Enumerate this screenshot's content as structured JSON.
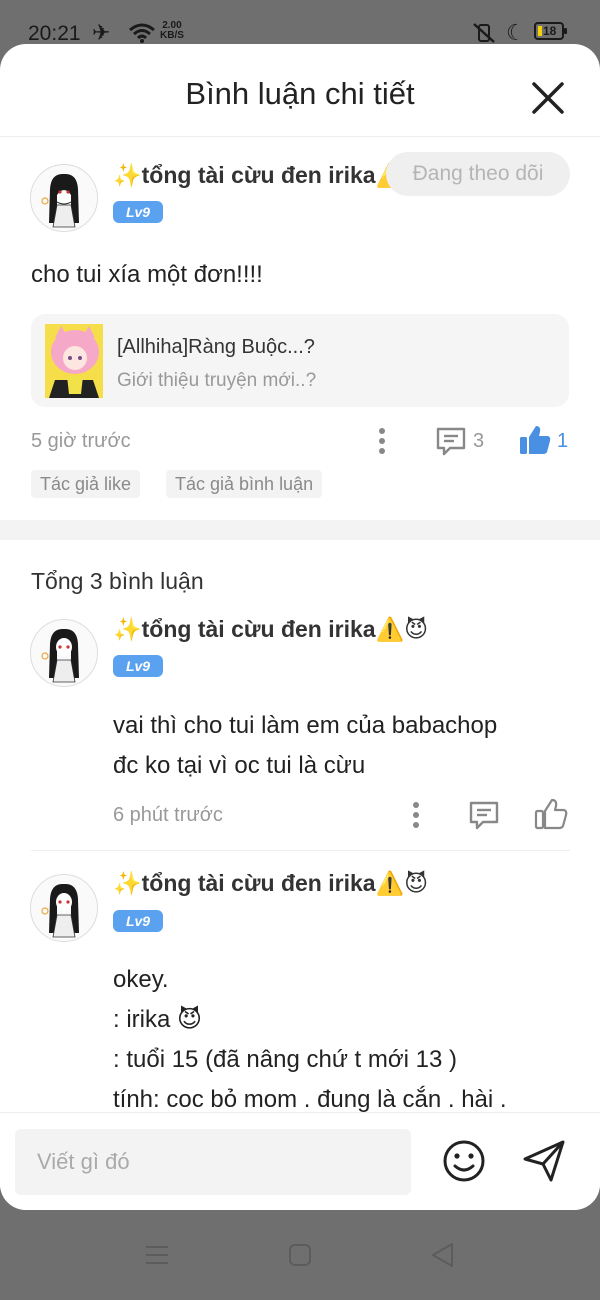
{
  "status": {
    "time": "20:21",
    "speed_top": "2.00",
    "speed_bottom": "KB/S",
    "battery": "18"
  },
  "header": {
    "title": "Bình luận chi tiết"
  },
  "post": {
    "username": "✨tổng tài cừu đen irika⚠️😈",
    "level": "Lv9",
    "follow_label": "Đang theo dõi",
    "text": "cho tui xía một đơn!!!!",
    "story": {
      "title": "[Allhiha]Ràng Buộc...?",
      "subtitle": "Giới thiệu truyện mới..?"
    },
    "time": "5 giờ trước",
    "comment_count": "3",
    "like_count": "1",
    "tags": [
      "Tác giả like",
      "Tác giả bình luận"
    ]
  },
  "total_label": "Tổng 3 bình luận",
  "comments": [
    {
      "username": "✨tổng tài cừu đen irika⚠️😈",
      "level": "Lv9",
      "lines": [
        "vai thì cho tui làm em của babachop",
        "đc ko tại vì oc tui là cừu"
      ],
      "time": "6 phút trước"
    },
    {
      "username": "✨tổng tài cừu đen irika⚠️😈",
      "level": "Lv9",
      "lines": [
        "okey.",
        ": irika 😈",
        ": tuổi 15 (đã nâng chứ t mới 13 )",
        "tính: coc bỏ mom . đung là cắn . hài ."
      ]
    }
  ],
  "input": {
    "placeholder": "Viết gì đó"
  },
  "colors": {
    "accent": "#4a90e2",
    "level_badge": "#5aa2f0",
    "overlay": "#6f6f6f"
  }
}
